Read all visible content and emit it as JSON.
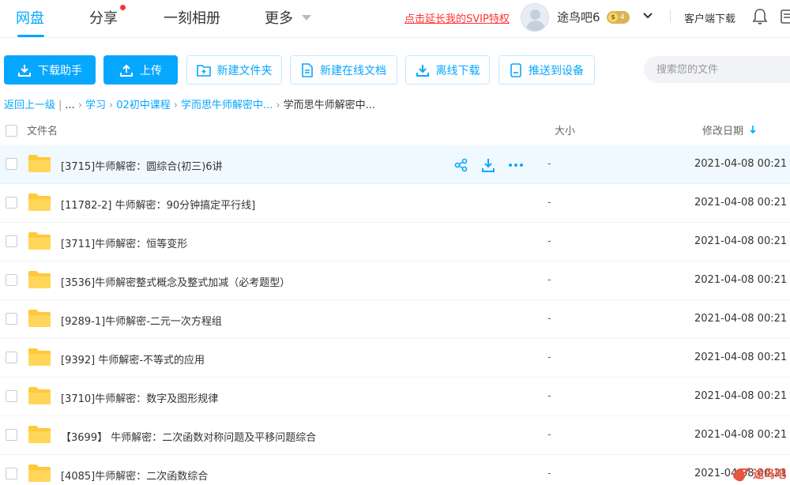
{
  "nav": {
    "tabs": [
      {
        "label": "网盘"
      },
      {
        "label": "分享"
      },
      {
        "label": "一刻相册"
      },
      {
        "label": "更多"
      }
    ],
    "promo": "点击延长我的SVIP特权",
    "username": "途鸟吧6",
    "vip_level": "4",
    "vip_coin": "$",
    "client_download": "客户端下载"
  },
  "toolbar": {
    "download_helper": "下载助手",
    "upload": "上传",
    "new_folder": "新建文件夹",
    "new_online_doc": "新建在线文档",
    "offline_download": "离线下载",
    "push_device": "推送到设备",
    "search_placeholder": "搜索您的文件"
  },
  "breadcrumb": {
    "back": "返回上一级",
    "ellipsis": "...",
    "items": [
      "学习",
      "02初中课程",
      "学而思牛师解密中..."
    ],
    "current": "学而思牛师解密中..."
  },
  "list": {
    "headers": {
      "name": "文件名",
      "size": "大小",
      "modified": "修改日期"
    },
    "rows": [
      {
        "name": "[3715]牛师解密：圆综合(初三)6讲",
        "size": "-",
        "date": "2021-04-08 00:21"
      },
      {
        "name": "[11782-2] 牛师解密：90分钟搞定平行线]",
        "size": "-",
        "date": "2021-04-08 00:21"
      },
      {
        "name": "[3711]牛师解密：恒等变形",
        "size": "-",
        "date": "2021-04-08 00:21"
      },
      {
        "name": "[3536]牛师解密整式概念及整式加减（必考题型）",
        "size": "-",
        "date": "2021-04-08 00:21"
      },
      {
        "name": "[9289-1]牛师解密-二元一次方程组",
        "size": "-",
        "date": "2021-04-08 00:21"
      },
      {
        "name": "[9392] 牛师解密-不等式的应用",
        "size": "-",
        "date": "2021-04-08 00:21"
      },
      {
        "name": "[3710]牛师解密：数字及图形规律",
        "size": "-",
        "date": "2021-04-08 00:21"
      },
      {
        "name": "【3699】 牛师解密：二次函数对称问题及平移问题综合",
        "size": "-",
        "date": "2021-04-08 00:21"
      },
      {
        "name": "[4085]牛师解密：二次函数综合",
        "size": "-",
        "date": "2021-04-08 00:21"
      }
    ]
  },
  "watermark": "途鸟吧",
  "colors": {
    "accent": "#06a7ff",
    "promo": "#ff3333",
    "folder": "#ffc93c"
  }
}
